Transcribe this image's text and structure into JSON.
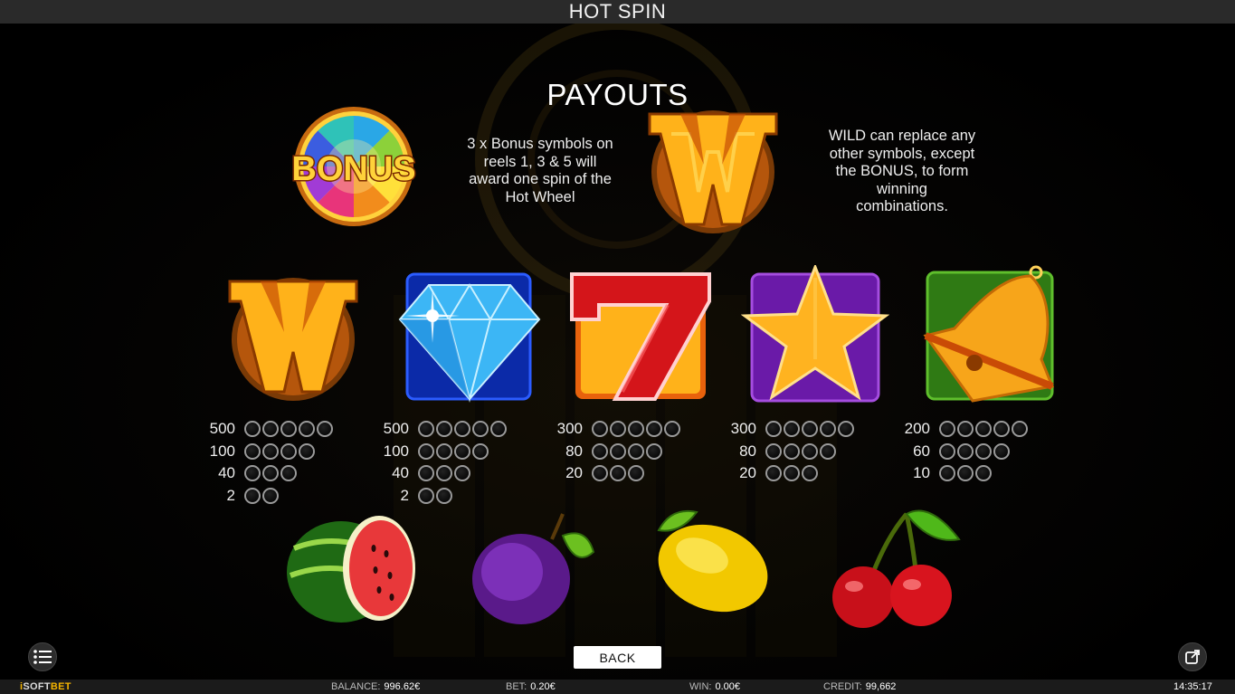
{
  "header": {
    "title": "HOT SPIN"
  },
  "payouts": {
    "title": "PAYOUTS",
    "bonus_desc": [
      "3 x Bonus symbols on",
      "reels 1, 3 & 5 will",
      "award one spin of the",
      "Hot Wheel"
    ],
    "wild_desc": [
      "WILD can replace any",
      "other symbols, except",
      "the BONUS, to form",
      "winning",
      "combinations."
    ],
    "bonus_symbol_label": "BONUS",
    "symbols": [
      {
        "name": "wild",
        "icon": "wild-w-icon",
        "pays": [
          {
            "value": "500",
            "count": 5
          },
          {
            "value": "100",
            "count": 4
          },
          {
            "value": "40",
            "count": 3
          },
          {
            "value": "2",
            "count": 2
          }
        ]
      },
      {
        "name": "diamond",
        "icon": "diamond-icon",
        "pays": [
          {
            "value": "500",
            "count": 5
          },
          {
            "value": "100",
            "count": 4
          },
          {
            "value": "40",
            "count": 3
          },
          {
            "value": "2",
            "count": 2
          }
        ]
      },
      {
        "name": "seven",
        "icon": "seven-icon",
        "pays": [
          {
            "value": "300",
            "count": 5
          },
          {
            "value": "80",
            "count": 4
          },
          {
            "value": "20",
            "count": 3
          }
        ]
      },
      {
        "name": "star",
        "icon": "star-icon",
        "pays": [
          {
            "value": "300",
            "count": 5
          },
          {
            "value": "80",
            "count": 4
          },
          {
            "value": "20",
            "count": 3
          }
        ]
      },
      {
        "name": "bell",
        "icon": "bell-icon",
        "pays": [
          {
            "value": "200",
            "count": 5
          },
          {
            "value": "60",
            "count": 4
          },
          {
            "value": "10",
            "count": 3
          }
        ]
      }
    ],
    "fruits": [
      "watermelon-icon",
      "plum-icon",
      "lemon-icon",
      "cherry-icon"
    ]
  },
  "controls": {
    "back_label": "BACK",
    "menu_icon": "menu-icon",
    "share_icon": "external-link-icon"
  },
  "footer": {
    "brand": "iSOFTBET",
    "brand_i": "i",
    "brand_soft": "SOFT",
    "brand_bet": "BET",
    "balance_label": "BALANCE:",
    "balance_value": "996.62€",
    "bet_label": "BET:",
    "bet_value": "0.20€",
    "win_label": "WIN:",
    "win_value": "0.00€",
    "credit_label": "CREDIT:",
    "credit_value": "99,662",
    "time": "14:35:17"
  },
  "colors": {
    "background": "#000000",
    "topbar": "#2a2a2a",
    "gold": "#f7b718",
    "red": "#d4151a",
    "blue": "#1742c9",
    "purple": "#6a1aa8",
    "green": "#3c8c1c"
  }
}
